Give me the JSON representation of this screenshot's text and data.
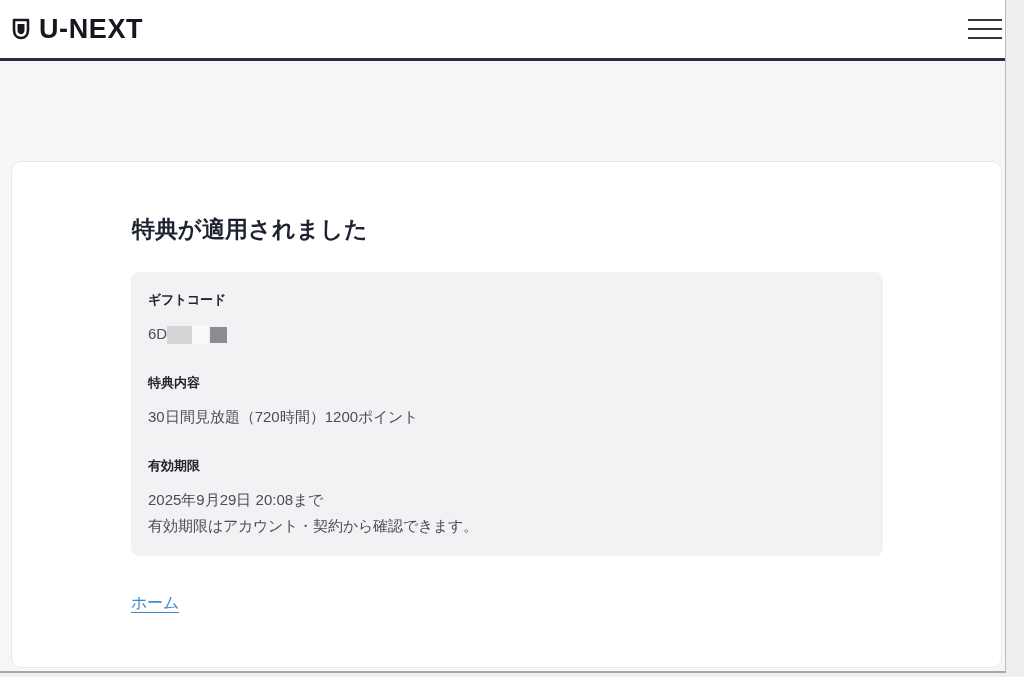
{
  "header": {
    "logo": "U-NEXT"
  },
  "card": {
    "title": "特典が適用されました",
    "details": [
      {
        "label": "ギフトコード",
        "lines": [
          "6D"
        ],
        "redacted": true
      },
      {
        "label": "特典内容",
        "lines": [
          "30日間見放題（720時間）1200ポイント"
        ],
        "redacted": false
      },
      {
        "label": "有効期限",
        "lines": [
          "2025年9月29日 20:08まで",
          "有効期限はアカウント・契約から確認できます。"
        ],
        "redacted": false
      }
    ],
    "link": "ホーム"
  }
}
